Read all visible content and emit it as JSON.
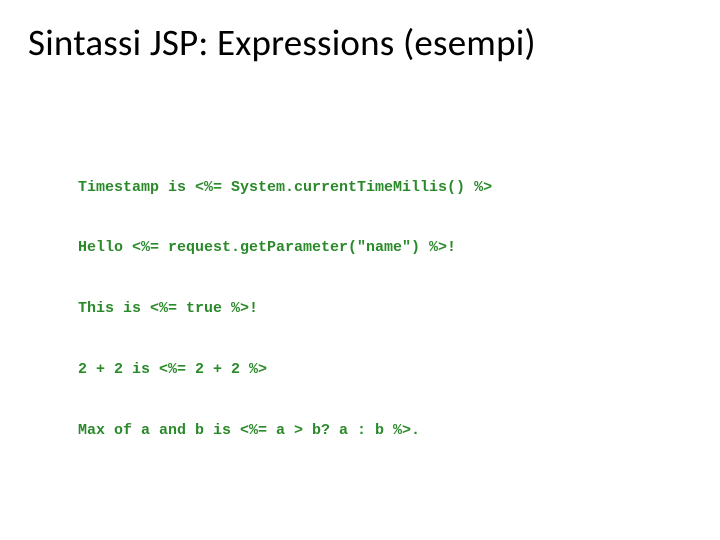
{
  "title": "Sintassi JSP: Expressions (esempi)",
  "code": {
    "lines": [
      "Timestamp is <%= System.currentTimeMillis() %>",
      "Hello <%= request.getParameter(\"name\") %>!",
      "This is <%= true %>!",
      "2 + 2 is <%= 2 + 2 %>",
      "Max of a and b is <%= a > b? a : b %>."
    ]
  }
}
